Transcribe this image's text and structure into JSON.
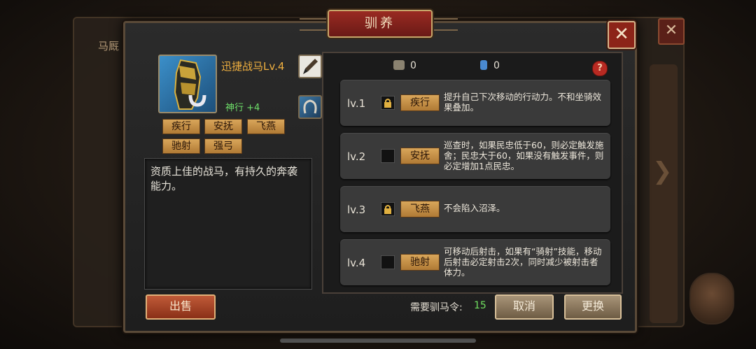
{
  "background": {
    "window_title": "马厩",
    "close_symbol": "✕"
  },
  "dialog": {
    "title": "驯养",
    "close_symbol": "✕"
  },
  "horse": {
    "name": "迅捷战马Lv.4",
    "skill": "神行 +4",
    "tags": [
      "疾行",
      "安抚",
      "飞燕",
      "驰射",
      "强弓"
    ],
    "description": "资质上佳的战马，有持久的奔袭能力。"
  },
  "resources": {
    "item1_count": "0",
    "item2_count": "0",
    "help": "?"
  },
  "levels": [
    {
      "level": "lv.1",
      "locked": true,
      "tag": "疾行",
      "desc": "提升自己下次移动的行动力。不和坐骑效果叠加。"
    },
    {
      "level": "lv.2",
      "locked": false,
      "tag": "安抚",
      "desc": "巡查时，如果民忠低于60，则必定触发施舍；民忠大于60，如果没有触发事件，则必定增加1点民忠。"
    },
    {
      "level": "lv.3",
      "locked": true,
      "tag": "飞燕",
      "desc": "不会陷入沼泽。"
    },
    {
      "level": "lv.4",
      "locked": false,
      "tag": "驰射",
      "desc": "可移动后射击，如果有“骑射”技能，移动后射击必定射击2次，同时减少被射击者体力。"
    }
  ],
  "footer": {
    "sell": "出售",
    "need_label": "需要驯马令:",
    "need_value": "15",
    "cancel": "取消",
    "replace": "更换"
  },
  "colors": {
    "accent_gold": "#d9a65a",
    "title_red": "#9a2a22",
    "green_text": "#6fe06a"
  }
}
